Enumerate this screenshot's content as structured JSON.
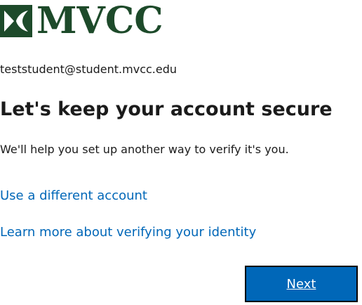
{
  "logo": {
    "text": "MVCC",
    "icon": "mvcc-leaf-logo-icon",
    "color": "#1d4a2a"
  },
  "identity": {
    "email": "teststudent@student.mvcc.edu"
  },
  "title": "Let's keep your account secure",
  "description": "We'll help you set up another way to verify it's you.",
  "links": {
    "different_account": "Use a different account",
    "learn_more": "Learn more about verifying your identity"
  },
  "buttons": {
    "next": "Next"
  },
  "colors": {
    "accent": "#0067b8",
    "text": "#1b1b1b",
    "button_border": "#000000"
  }
}
